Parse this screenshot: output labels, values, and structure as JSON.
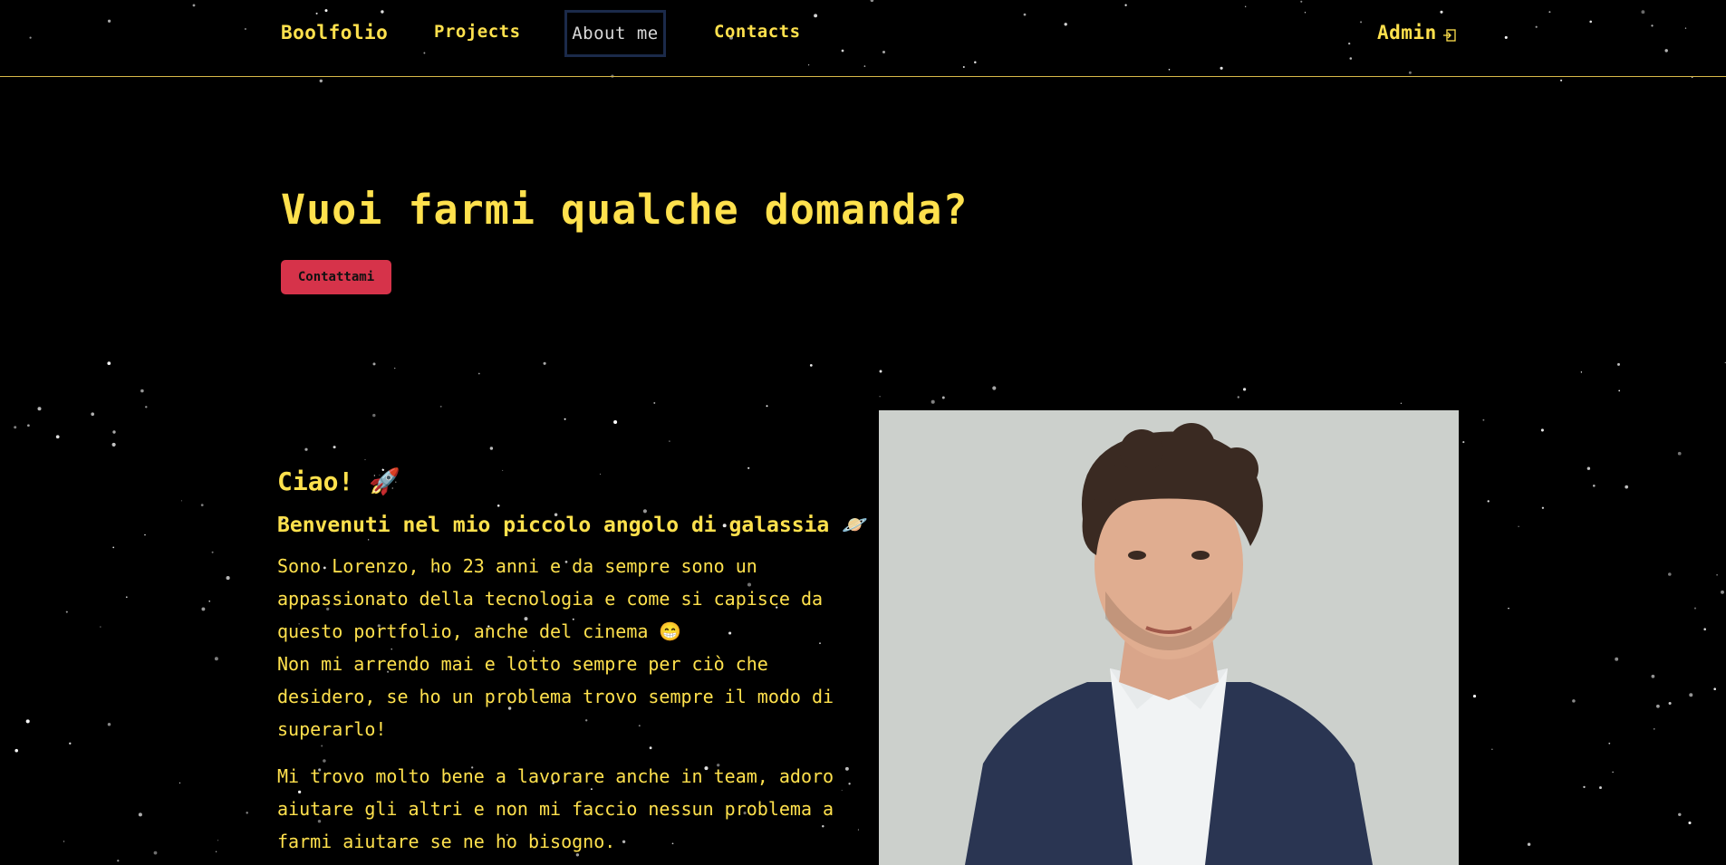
{
  "nav": {
    "brand": "Boolfolio",
    "projects": "Projects",
    "about": "About me",
    "contacts": "Contacts",
    "admin": "Admin",
    "admin_icon": "login-icon"
  },
  "hero": {
    "title": "Vuoi farmi qualche domanda?",
    "button": "Contattami"
  },
  "about": {
    "greeting": "Ciao! 🚀",
    "subtitle": "Benvenuti nel mio piccolo angolo di galassia 🪐",
    "para1_line1": "Sono Lorenzo, ho 23 anni e da sempre sono un appassionato della tecnologia e come si capisce da questo portfolio, anche del cinema 😁",
    "para1_line2": "Non mi arrendo mai e lotto sempre per ciò che desidero, se ho un problema trovo sempre il modo di superarlo!",
    "para2": "Mi trovo molto bene a lavorare anche in team, adoro aiutare gli altri e non mi faccio nessun problema a farmi aiutare se ne ho bisogno."
  },
  "colors": {
    "accent": "#ffe14d",
    "button": "#d6334a",
    "background": "#000000",
    "divider": "#d8b84a"
  }
}
